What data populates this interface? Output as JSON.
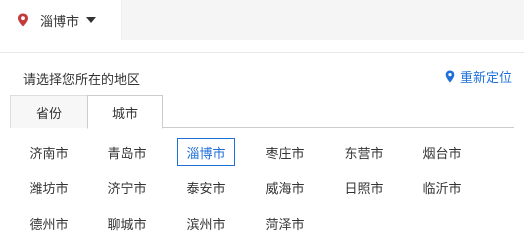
{
  "header": {
    "current_city": "淄博市"
  },
  "panel": {
    "prompt": "请选择您所在的地区",
    "relocate_label": "重新定位"
  },
  "tabs": [
    {
      "label": "省份",
      "active": false
    },
    {
      "label": "城市",
      "active": true
    }
  ],
  "cities": [
    {
      "name": "济南市",
      "selected": false
    },
    {
      "name": "青岛市",
      "selected": false
    },
    {
      "name": "淄博市",
      "selected": true
    },
    {
      "name": "枣庄市",
      "selected": false
    },
    {
      "name": "东营市",
      "selected": false
    },
    {
      "name": "烟台市",
      "selected": false
    },
    {
      "name": "潍坊市",
      "selected": false
    },
    {
      "name": "济宁市",
      "selected": false
    },
    {
      "name": "泰安市",
      "selected": false
    },
    {
      "name": "威海市",
      "selected": false
    },
    {
      "name": "日照市",
      "selected": false
    },
    {
      "name": "临沂市",
      "selected": false
    },
    {
      "name": "德州市",
      "selected": false
    },
    {
      "name": "聊城市",
      "selected": false
    },
    {
      "name": "滨州市",
      "selected": false
    },
    {
      "name": "菏泽市",
      "selected": false
    }
  ],
  "colors": {
    "accent": "#1e6fd9",
    "pin_red": "#c23a3a",
    "text": "#333333"
  },
  "icons": {
    "location": "map-pin-icon",
    "dropdown": "caret-down-icon",
    "relocate": "map-pin-icon"
  }
}
